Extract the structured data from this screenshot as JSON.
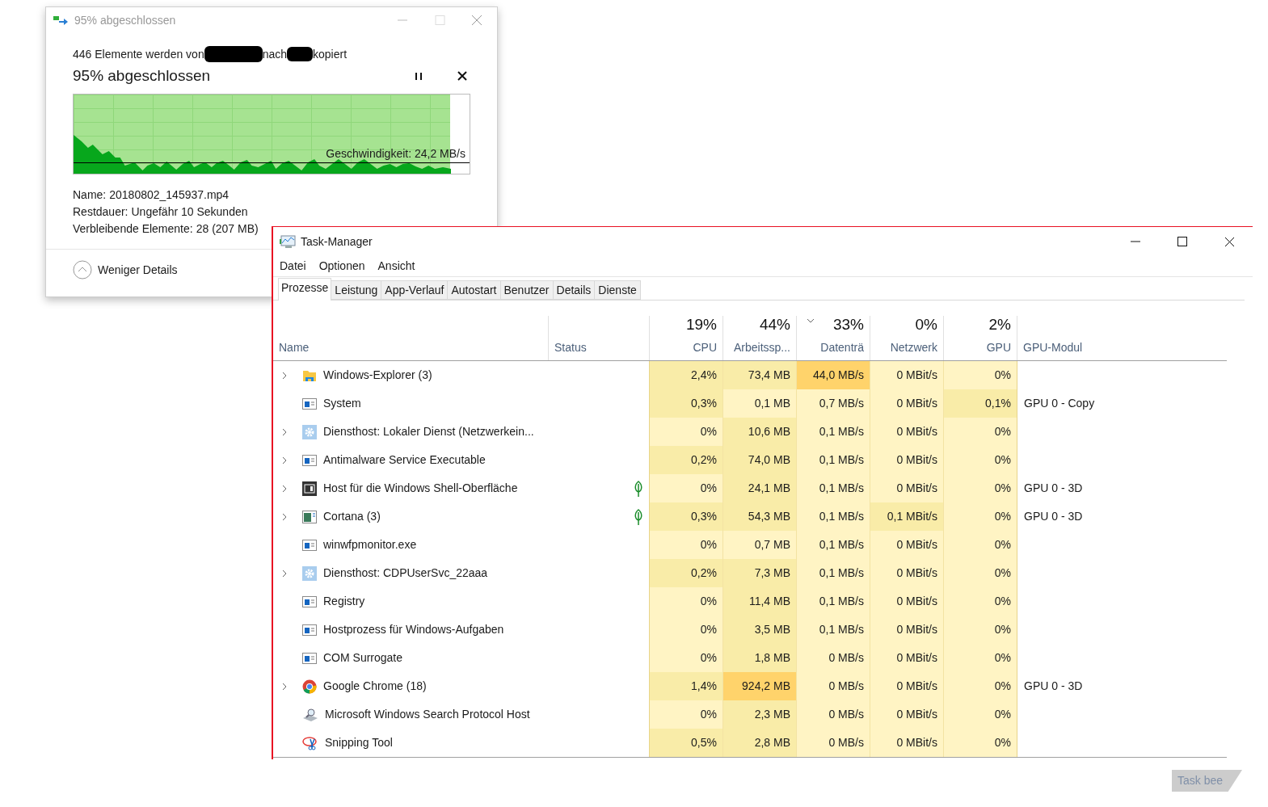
{
  "copy_dialog": {
    "title": "95% abgeschlossen",
    "summary": [
      "446 Elemente werden von",
      "nach",
      "kopiert"
    ],
    "heading": "95% abgeschlossen",
    "progress": {
      "level": 0.95
    },
    "speed": "Geschwindigkeit: 24,2 MB/s",
    "details": [
      {
        "label": "Name:",
        "value": "20180802_145937.mp4"
      },
      {
        "label": "Restdauer:",
        "value": "Ungefähr 10 Sekunden"
      },
      {
        "label": "Verbleibende Elemente:",
        "value": "28 (207 MB)"
      }
    ],
    "toggle": "Weniger Details"
  },
  "task_manager": {
    "title": "Task-Manager",
    "menu": [
      "Datei",
      "Optionen",
      "Ansicht"
    ],
    "tabs": [
      {
        "label": "Prozesse",
        "selected": true
      },
      {
        "label": "Leistung",
        "selected": false
      },
      {
        "label": "App-Verlauf",
        "selected": false
      },
      {
        "label": "Autostart",
        "selected": false
      },
      {
        "label": "Benutzer",
        "selected": false
      },
      {
        "label": "Details",
        "selected": false
      },
      {
        "label": "Dienste",
        "selected": false
      }
    ],
    "columns": [
      {
        "label": "Name",
        "sorted": false
      },
      {
        "label": "Status",
        "sorted": false
      },
      {
        "label": "CPU",
        "total": "19%",
        "sorted": false
      },
      {
        "label": "Arbeitssp...",
        "total": "44%",
        "sorted": false
      },
      {
        "label": "Datenträ",
        "total": "33%",
        "sorted": true
      },
      {
        "label": "Netzwerk",
        "total": "0%",
        "sorted": false
      },
      {
        "label": "GPU",
        "total": "2%",
        "sorted": false
      },
      {
        "label": "GPU-Modul",
        "sorted": false
      }
    ],
    "rows": [
      {
        "kind": "folder",
        "expandable": true,
        "eco": false,
        "cells": [
          {
            "kind": "name",
            "text": "Windows-Explorer (3)"
          },
          {
            "kind": "blank"
          },
          {
            "kind": "medium",
            "text": "2,4%"
          },
          {
            "kind": "medium",
            "text": "73,4 MB"
          },
          {
            "kind": "high",
            "text": "44,0 MB/s"
          },
          {
            "kind": "low",
            "text": "0 MBit/s"
          },
          {
            "kind": "low",
            "text": "0%"
          },
          {
            "kind": "blank"
          }
        ]
      },
      {
        "kind": "app",
        "expandable": false,
        "eco": false,
        "cells": [
          {
            "kind": "name",
            "text": "System"
          },
          {
            "kind": "blank"
          },
          {
            "kind": "medium",
            "text": "0,3%"
          },
          {
            "kind": "low",
            "text": "0,1 MB"
          },
          {
            "kind": "low",
            "text": "0,7 MB/s"
          },
          {
            "kind": "low",
            "text": "0 MBit/s"
          },
          {
            "kind": "medium",
            "text": "0,1%"
          },
          {
            "kind": "module",
            "text": "GPU 0 - Copy"
          }
        ]
      },
      {
        "kind": "gear",
        "expandable": true,
        "eco": false,
        "cells": [
          {
            "kind": "name",
            "text": "Diensthost: Lokaler Dienst (Netzwerkein..."
          },
          {
            "kind": "blank"
          },
          {
            "kind": "low",
            "text": "0%"
          },
          {
            "kind": "medium",
            "text": "10,6 MB"
          },
          {
            "kind": "low",
            "text": "0,1 MB/s"
          },
          {
            "kind": "low",
            "text": "0 MBit/s"
          },
          {
            "kind": "low",
            "text": "0%"
          },
          {
            "kind": "blank"
          }
        ]
      },
      {
        "kind": "app",
        "expandable": true,
        "eco": false,
        "cells": [
          {
            "kind": "name",
            "text": "Antimalware Service Executable"
          },
          {
            "kind": "blank"
          },
          {
            "kind": "medium",
            "text": "0,2%"
          },
          {
            "kind": "medium",
            "text": "74,0 MB"
          },
          {
            "kind": "low",
            "text": "0,1 MB/s"
          },
          {
            "kind": "low",
            "text": "0 MBit/s"
          },
          {
            "kind": "low",
            "text": "0%"
          },
          {
            "kind": "blank"
          }
        ]
      },
      {
        "kind": "shell",
        "expandable": true,
        "eco": true,
        "cells": [
          {
            "kind": "name",
            "text": "Host für die Windows Shell-Oberfläche"
          },
          {
            "kind": "blank"
          },
          {
            "kind": "low",
            "text": "0%"
          },
          {
            "kind": "medium",
            "text": "24,1 MB"
          },
          {
            "kind": "low",
            "text": "0,1 MB/s"
          },
          {
            "kind": "low",
            "text": "0 MBit/s"
          },
          {
            "kind": "low",
            "text": "0%"
          },
          {
            "kind": "module",
            "text": "GPU 0 - 3D"
          }
        ]
      },
      {
        "kind": "window",
        "expandable": true,
        "eco": true,
        "cells": [
          {
            "kind": "name",
            "text": "Cortana (3)"
          },
          {
            "kind": "blank"
          },
          {
            "kind": "medium",
            "text": "0,3%"
          },
          {
            "kind": "medium",
            "text": "54,3 MB"
          },
          {
            "kind": "low",
            "text": "0,1 MB/s"
          },
          {
            "kind": "medium",
            "text": "0,1 MBit/s"
          },
          {
            "kind": "low",
            "text": "0%"
          },
          {
            "kind": "module",
            "text": "GPU 0 - 3D"
          }
        ]
      },
      {
        "kind": "app",
        "expandable": false,
        "eco": false,
        "cells": [
          {
            "kind": "name",
            "text": "winwfpmonitor.exe"
          },
          {
            "kind": "blank"
          },
          {
            "kind": "low",
            "text": "0%"
          },
          {
            "kind": "low",
            "text": "0,7 MB"
          },
          {
            "kind": "low",
            "text": "0,1 MB/s"
          },
          {
            "kind": "low",
            "text": "0 MBit/s"
          },
          {
            "kind": "low",
            "text": "0%"
          },
          {
            "kind": "blank"
          }
        ]
      },
      {
        "kind": "gear",
        "expandable": true,
        "eco": false,
        "cells": [
          {
            "kind": "name",
            "text": "Diensthost: CDPUserSvc_22aaa"
          },
          {
            "kind": "blank"
          },
          {
            "kind": "medium",
            "text": "0,2%"
          },
          {
            "kind": "medium",
            "text": "7,3 MB"
          },
          {
            "kind": "low",
            "text": "0,1 MB/s"
          },
          {
            "kind": "low",
            "text": "0 MBit/s"
          },
          {
            "kind": "low",
            "text": "0%"
          },
          {
            "kind": "blank"
          }
        ]
      },
      {
        "kind": "app",
        "expandable": false,
        "eco": false,
        "cells": [
          {
            "kind": "name",
            "text": "Registry"
          },
          {
            "kind": "blank"
          },
          {
            "kind": "low",
            "text": "0%"
          },
          {
            "kind": "medium",
            "text": "11,4 MB"
          },
          {
            "kind": "low",
            "text": "0,1 MB/s"
          },
          {
            "kind": "low",
            "text": "0 MBit/s"
          },
          {
            "kind": "low",
            "text": "0%"
          },
          {
            "kind": "blank"
          }
        ]
      },
      {
        "kind": "app",
        "expandable": false,
        "eco": false,
        "cells": [
          {
            "kind": "name",
            "text": "Hostprozess für Windows-Aufgaben"
          },
          {
            "kind": "blank"
          },
          {
            "kind": "low",
            "text": "0%"
          },
          {
            "kind": "medium",
            "text": "3,5 MB"
          },
          {
            "kind": "low",
            "text": "0,1 MB/s"
          },
          {
            "kind": "low",
            "text": "0 MBit/s"
          },
          {
            "kind": "low",
            "text": "0%"
          },
          {
            "kind": "blank"
          }
        ]
      },
      {
        "kind": "app",
        "expandable": false,
        "eco": false,
        "cells": [
          {
            "kind": "name",
            "text": "COM Surrogate"
          },
          {
            "kind": "blank"
          },
          {
            "kind": "low",
            "text": "0%"
          },
          {
            "kind": "medium",
            "text": "1,8 MB"
          },
          {
            "kind": "low",
            "text": "0 MB/s"
          },
          {
            "kind": "low",
            "text": "0 MBit/s"
          },
          {
            "kind": "low",
            "text": "0%"
          },
          {
            "kind": "blank"
          }
        ]
      },
      {
        "kind": "browser",
        "expandable": true,
        "eco": false,
        "cells": [
          {
            "kind": "name",
            "text": "Google Chrome (18)"
          },
          {
            "kind": "blank"
          },
          {
            "kind": "medium",
            "text": "1,4%"
          },
          {
            "kind": "high",
            "text": "924,2 MB"
          },
          {
            "kind": "low",
            "text": "0 MB/s"
          },
          {
            "kind": "low",
            "text": "0 MBit/s"
          },
          {
            "kind": "low",
            "text": "0%"
          },
          {
            "kind": "module",
            "text": "GPU 0 - 3D"
          }
        ]
      },
      {
        "kind": "search",
        "expandable": false,
        "eco": false,
        "cells": [
          {
            "kind": "name",
            "text": "Microsoft Windows Search Protocol Host"
          },
          {
            "kind": "blank"
          },
          {
            "kind": "low",
            "text": "0%"
          },
          {
            "kind": "medium",
            "text": "2,3 MB"
          },
          {
            "kind": "low",
            "text": "0 MB/s"
          },
          {
            "kind": "low",
            "text": "0 MBit/s"
          },
          {
            "kind": "low",
            "text": "0%"
          },
          {
            "kind": "blank"
          }
        ]
      },
      {
        "kind": "scissors",
        "expandable": false,
        "eco": false,
        "cells": [
          {
            "kind": "name",
            "text": "Snipping Tool"
          },
          {
            "kind": "blank"
          },
          {
            "kind": "medium",
            "text": "0,5%"
          },
          {
            "kind": "medium",
            "text": "2,8 MB"
          },
          {
            "kind": "low",
            "text": "0 MB/s"
          },
          {
            "kind": "low",
            "text": "0 MBit/s"
          },
          {
            "kind": "low",
            "text": "0%"
          },
          {
            "kind": "blank"
          }
        ]
      }
    ],
    "end_task_button": "Task bee"
  }
}
